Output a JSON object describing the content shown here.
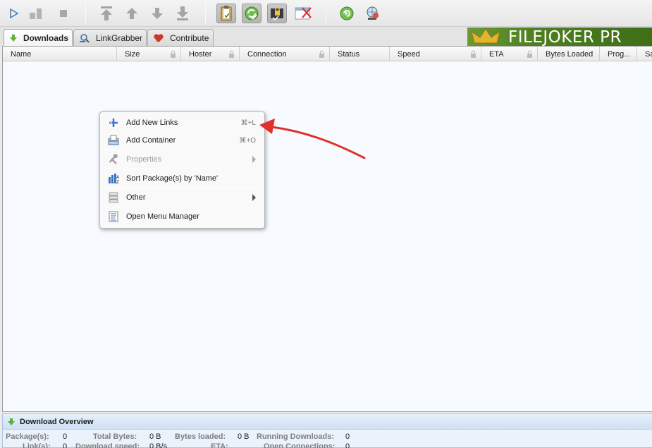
{
  "toolbar": {
    "buttons": [
      {
        "icon": "play-icon"
      },
      {
        "icon": "pause-icon"
      },
      {
        "icon": "stop-icon"
      },
      {
        "icon": "move-top-icon"
      },
      {
        "icon": "move-up-icon"
      },
      {
        "icon": "move-down-icon"
      },
      {
        "icon": "move-bottom-icon"
      },
      {
        "icon": "clipboard-observer-icon"
      },
      {
        "icon": "auto-reconnect-icon"
      },
      {
        "icon": "premium-lock-icon"
      },
      {
        "icon": "silent-mode-icon"
      },
      {
        "icon": "update-icon"
      },
      {
        "icon": "reconnect-icon"
      }
    ]
  },
  "tabs": [
    {
      "label": "Downloads",
      "icon": "download-arrow-icon",
      "active": true
    },
    {
      "label": "LinkGrabber",
      "icon": "linkgrabber-icon",
      "active": false
    },
    {
      "label": "Contribute",
      "icon": "heart-icon",
      "active": false
    }
  ],
  "banner": {
    "text": "FILEJOKER PR"
  },
  "table": {
    "columns": [
      "Name",
      "Size",
      "Hoster",
      "Connection",
      "Status",
      "Speed",
      "ETA",
      "Bytes Loaded",
      "Prog...",
      "Sa"
    ]
  },
  "context_menu": {
    "items": [
      {
        "label": "Add New Links",
        "shortcut": "⌘+L",
        "icon": "add-links-icon",
        "enabled": true
      },
      {
        "label": "Add Container",
        "shortcut": "⌘+O",
        "icon": "add-container-icon",
        "enabled": true
      },
      {
        "label": "Properties",
        "icon": "wrench-icon",
        "enabled": false,
        "submenu": true
      },
      {
        "label": "Sort Package(s) by 'Name'",
        "icon": "sort-icon",
        "enabled": true
      },
      {
        "label": "Other",
        "icon": "other-icon",
        "enabled": true,
        "submenu": true
      },
      {
        "label": "Open Menu Manager",
        "icon": "menu-manager-icon",
        "enabled": true
      }
    ]
  },
  "overview": {
    "title": "Download Overview",
    "row1": [
      {
        "label": "Package(s):",
        "value": "0"
      },
      {
        "label": "Total Bytes:",
        "value": "0 B"
      },
      {
        "label": "Bytes loaded:",
        "value": "0 B"
      },
      {
        "label": "Running Downloads:",
        "value": "0"
      }
    ],
    "row2": [
      {
        "label": "Link(s):",
        "value": "0"
      },
      {
        "label": "Download speed:",
        "value": "0 B/s"
      },
      {
        "label": "ETA:",
        "value": ""
      },
      {
        "label": "Open Connections:",
        "value": "0"
      }
    ]
  },
  "colors": {
    "accent_green": "#5a8f26",
    "annotation_arrow": "#e0302a",
    "table_bg": "#f7fbff"
  }
}
